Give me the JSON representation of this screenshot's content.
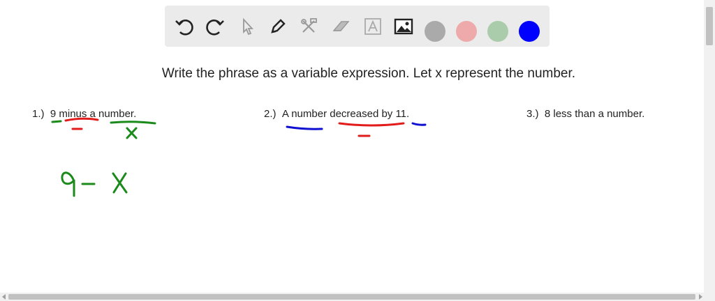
{
  "toolbar": {
    "tools": [
      {
        "name": "undo-icon"
      },
      {
        "name": "redo-icon"
      },
      {
        "name": "select-pointer-icon"
      },
      {
        "name": "pen-icon"
      },
      {
        "name": "tools-icon"
      },
      {
        "name": "eraser-icon"
      },
      {
        "name": "text-box-icon"
      },
      {
        "name": "image-icon"
      }
    ],
    "colors": [
      "#aaaaaa",
      "#eeaaaa",
      "#aaccaa",
      "#0000ff"
    ]
  },
  "prompt": "Write the phrase as a variable expression. Let x represent the number.",
  "problems": [
    {
      "number": "1.)",
      "text": "9 minus a number."
    },
    {
      "number": "2.)",
      "text": "A number decreased by 11."
    },
    {
      "number": "3.)",
      "text": "8 less than a number."
    }
  ],
  "handwriting": {
    "minus_sign": "−",
    "variable_mark": "x",
    "answer_1": "9 - x"
  },
  "ink_colors": {
    "green": "#1a8a1a",
    "red": "#e21b1b",
    "blue": "#1010d0"
  }
}
